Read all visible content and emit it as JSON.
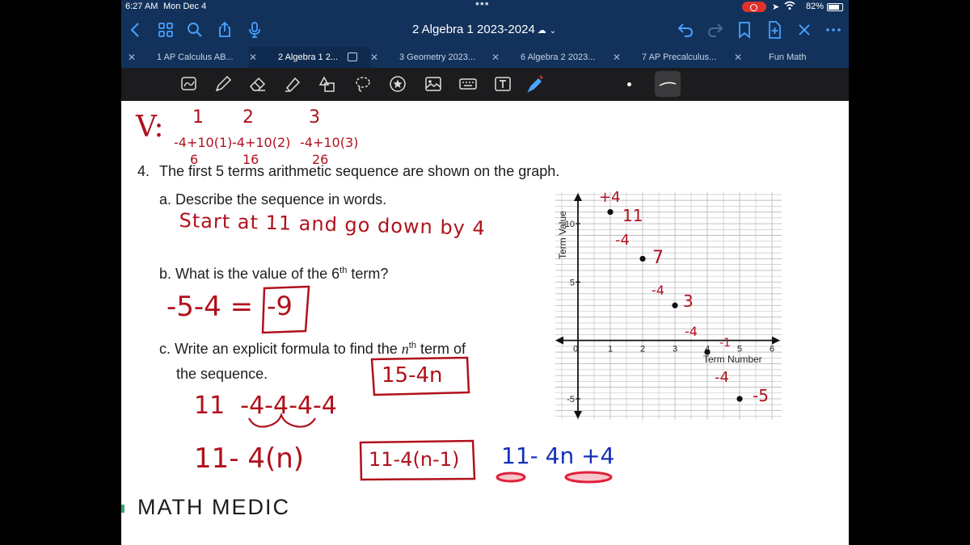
{
  "status_bar": {
    "time": "6:27 AM",
    "date": "Mon Dec 4",
    "battery_percent": "82%",
    "battery_level": 0.82
  },
  "nav": {
    "doc_title": "2 Algebra 1 2023-2024",
    "icons": [
      "back-icon",
      "grid-icon",
      "search-icon",
      "share-icon",
      "microphone-icon",
      "undo-icon",
      "redo-icon",
      "bookmark-icon",
      "add-page-icon",
      "close-icon",
      "more-icon"
    ]
  },
  "tabs": [
    {
      "label": "1 AP Calculus AB...",
      "active": false
    },
    {
      "label": "2 Algebra 1 2...",
      "active": true
    },
    {
      "label": "3 Geometry 2023...",
      "active": false
    },
    {
      "label": "6 Algebra 2 2023...",
      "active": false
    },
    {
      "label": "7 AP Precalculus...",
      "active": false
    },
    {
      "label": "Fun Math",
      "active": false
    }
  ],
  "toolbar": {
    "tools": [
      "lasso-image-icon",
      "pen-icon",
      "eraser-icon",
      "highlighter-icon",
      "shapes-icon",
      "lasso-icon",
      "sticker-icon",
      "image-icon",
      "keyboard-icon",
      "text-box-icon",
      "bluetooth-pen-icon"
    ],
    "accent": "#b0111c"
  },
  "page": {
    "q4_number": "4.",
    "q4_text": "The first 5 terms arithmetic sequence are shown on the graph.",
    "qa_text": "a. Describe the sequence in words.",
    "qb_text_pre": "b. What is the value of the 6",
    "qb_sup": "th",
    "qb_text_post": " term?",
    "qc_text_pre": "c. Write an explicit formula to find the ",
    "qc_n": "n",
    "qc_sup": "th",
    "qc_text_post": " term of",
    "qc_line2": "the sequence.",
    "brand": "MATH MEDIC"
  },
  "handwriting": {
    "top_v": "V:",
    "top_cols": [
      {
        "n": "1",
        "expr": "-4+10(1)",
        "val": "6"
      },
      {
        "n": "2",
        "expr": "-4+10(2)",
        "val": "16"
      },
      {
        "n": "3",
        "expr": "-4+10(3)",
        "val": "26"
      }
    ],
    "answer_a": "Start at 11 and go down by 4",
    "answer_b": "-5-4 =",
    "answer_b_box": "-9",
    "formula_box_1": "15-4n",
    "seq_line": "11  -4-4-4-4",
    "line_11_4n": "11- 4(n)",
    "formula_box_2": "11-4(n-1)",
    "blue_formula": "11- 4n +4",
    "graph_notes": [
      "+4",
      "11",
      "-4",
      "7",
      "-4",
      "3",
      "-4",
      "-1",
      "-4",
      "-5"
    ]
  },
  "chart_data": {
    "type": "scatter",
    "xlabel": "Term Number",
    "ylabel": "Term Value",
    "x_ticks": [
      "0",
      "1",
      "2",
      "3",
      "4",
      "5",
      "6"
    ],
    "y_ticks": [
      "10",
      "5",
      "-5"
    ],
    "xlim": [
      -0.7,
      6.3
    ],
    "ylim": [
      -6.8,
      12.7
    ],
    "grid": true,
    "series": [
      {
        "x": [
          1,
          2,
          3,
          4,
          5
        ],
        "values": [
          11,
          7,
          3,
          -1,
          -5
        ]
      }
    ]
  }
}
